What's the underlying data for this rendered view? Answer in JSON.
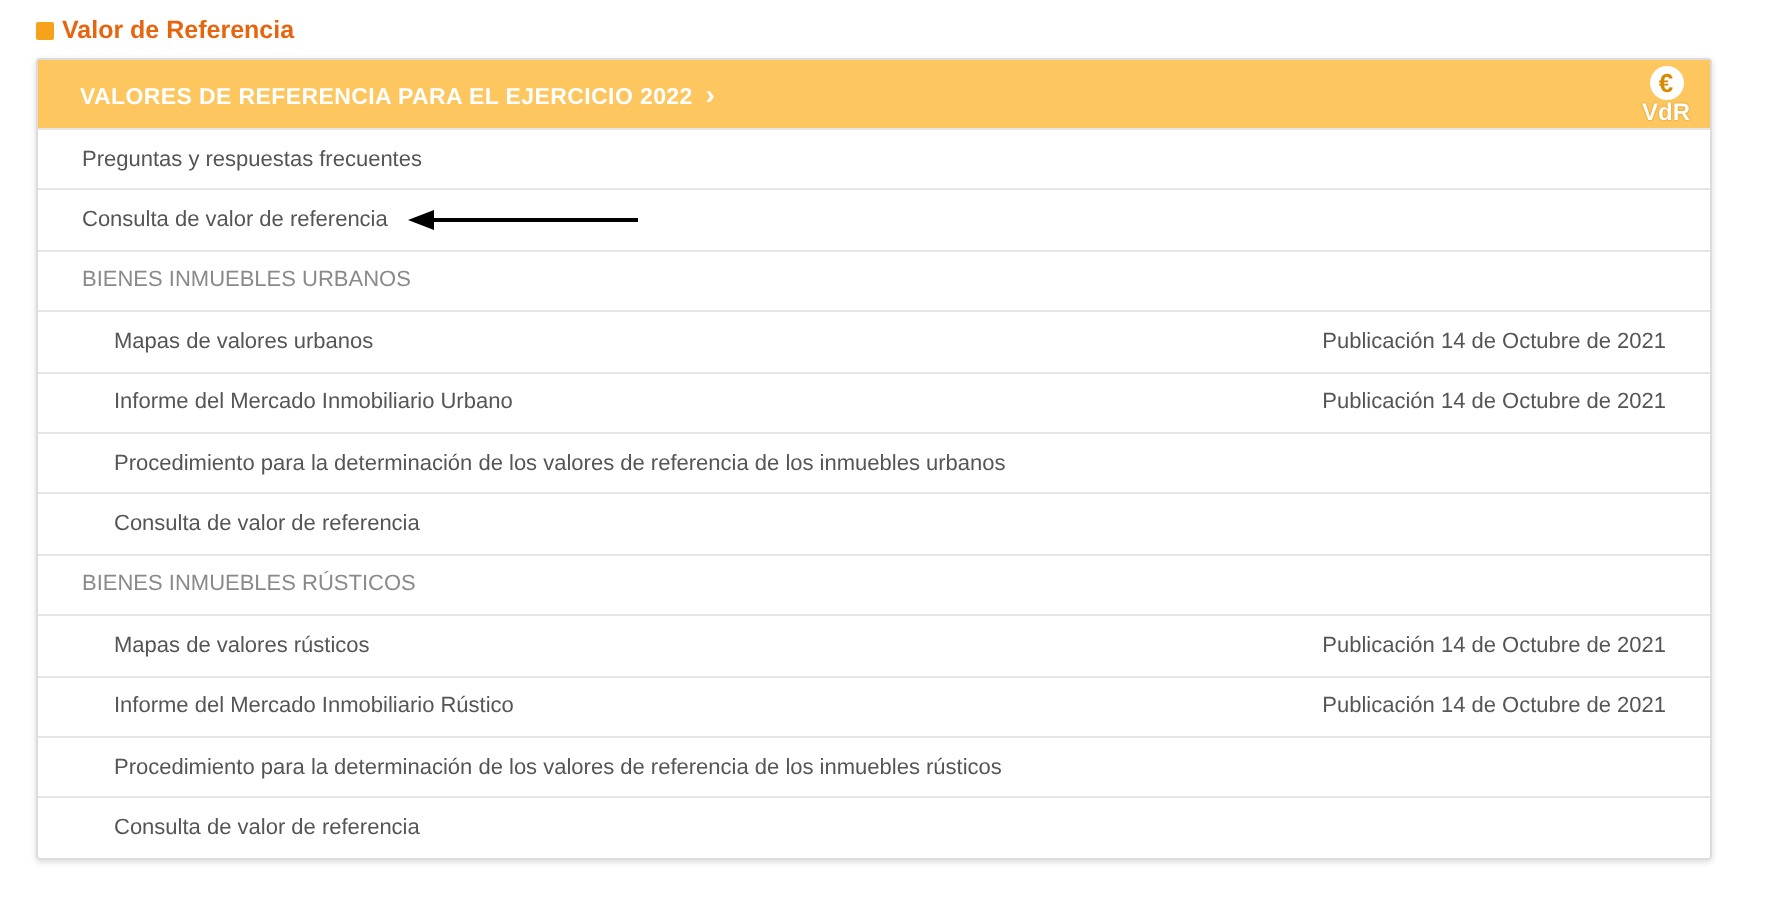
{
  "page_title": "Valor de Referencia",
  "panel": {
    "title": "VALORES DE REFERENCIA PARA EL EJERCICIO 2022",
    "chevron": "›",
    "logo_symbol": "€",
    "logo_text": "VdR"
  },
  "rows": [
    {
      "kind": "link",
      "label": "Preguntas y respuestas frecuentes",
      "annotated": false
    },
    {
      "kind": "link",
      "label": "Consulta de valor de referencia",
      "annotated": true
    },
    {
      "kind": "section",
      "label": "BIENES INMUEBLES URBANOS",
      "annotated": false
    },
    {
      "kind": "item",
      "label": "Mapas de valores urbanos",
      "date": "Publicación 14 de Octubre de 2021",
      "annotated": false
    },
    {
      "kind": "item",
      "label": "Informe del Mercado Inmobiliario Urbano",
      "date": "Publicación 14 de Octubre de 2021",
      "annotated": false
    },
    {
      "kind": "item",
      "label": "Procedimiento para la determinación de los valores de referencia de los inmuebles urbanos",
      "annotated": false
    },
    {
      "kind": "item",
      "label": "Consulta de valor de referencia",
      "annotated": false
    },
    {
      "kind": "section",
      "label": "BIENES INMUEBLES RÚSTICOS",
      "annotated": false
    },
    {
      "kind": "item",
      "label": "Mapas de valores rústicos",
      "date": "Publicación 14 de Octubre de 2021",
      "annotated": false
    },
    {
      "kind": "item",
      "label": "Informe del Mercado Inmobiliario Rústico",
      "date": "Publicación 14 de Octubre de 2021",
      "annotated": false
    },
    {
      "kind": "item",
      "label": "Procedimiento para la determinación de los valores de referencia de los inmuebles rústicos",
      "annotated": false
    },
    {
      "kind": "item",
      "label": "Consulta de valor de referencia",
      "annotated": false
    }
  ]
}
